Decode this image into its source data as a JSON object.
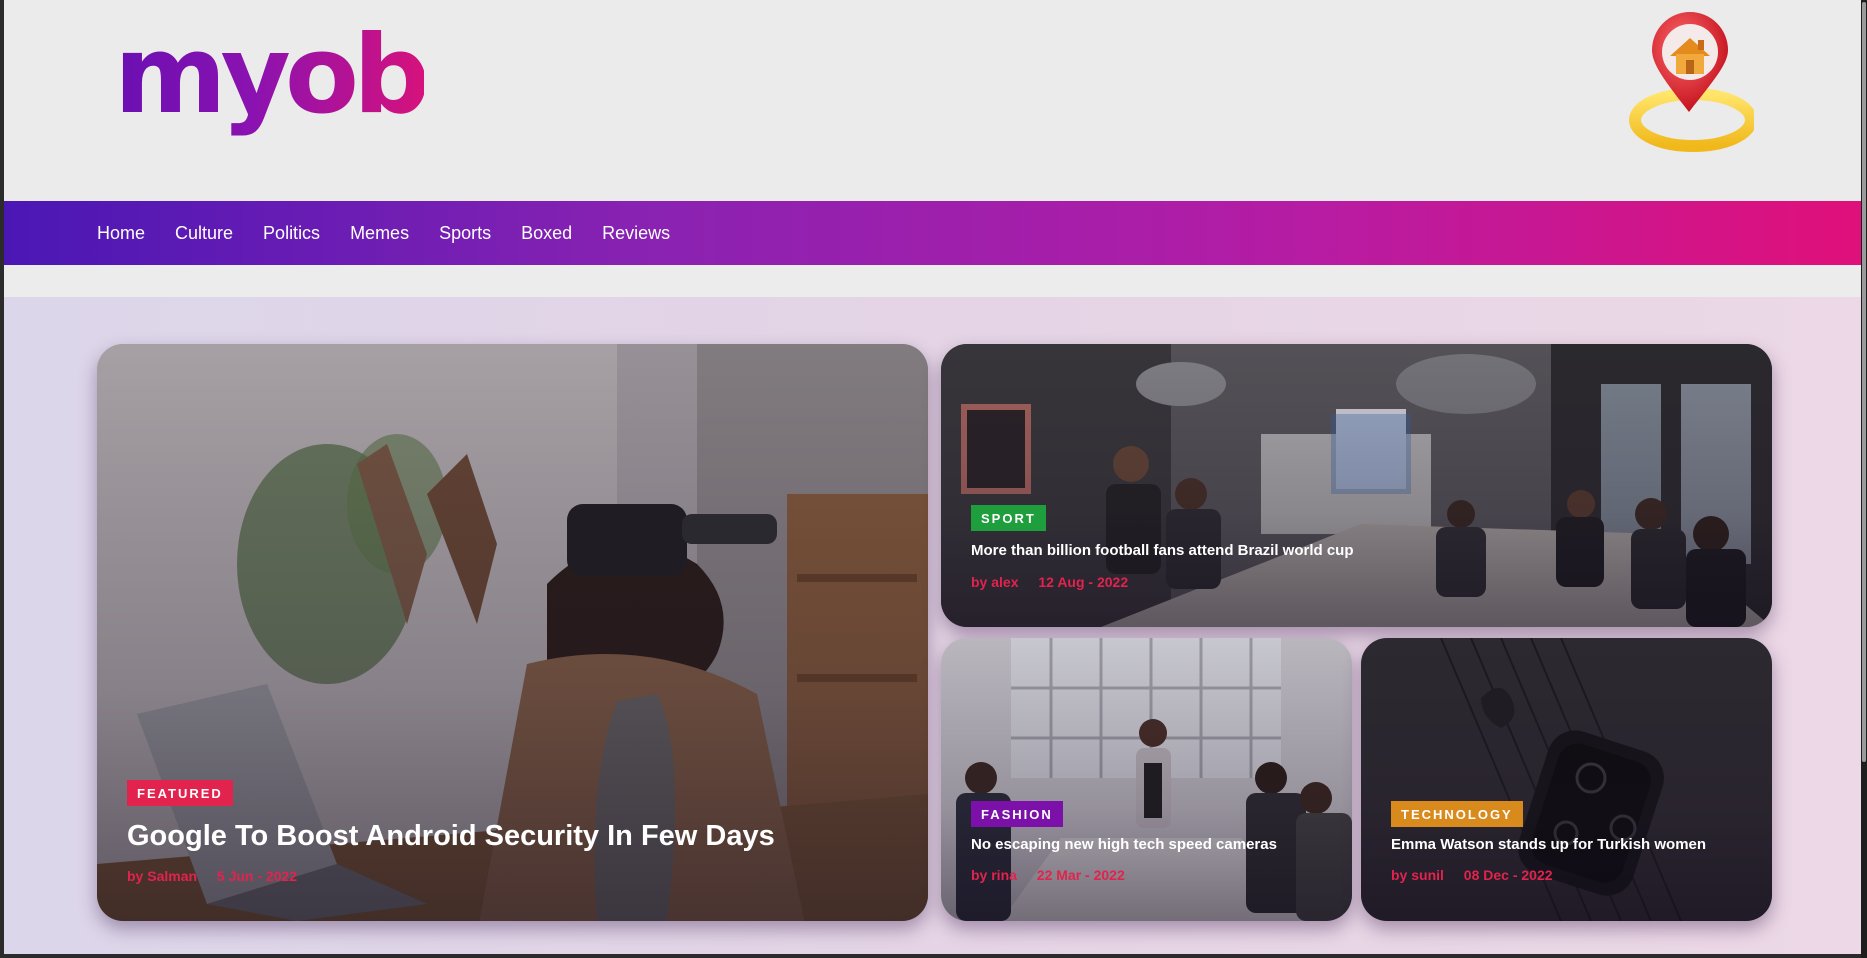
{
  "site": {
    "logo_text": "myob",
    "brand_colors": {
      "purple": "#6a0fb2",
      "pink": "#d6127c"
    }
  },
  "nav": {
    "items": [
      {
        "label": "Home"
      },
      {
        "label": "Culture"
      },
      {
        "label": "Politics"
      },
      {
        "label": "Memes"
      },
      {
        "label": "Sports"
      },
      {
        "label": "Boxed"
      },
      {
        "label": "Reviews"
      }
    ]
  },
  "header": {
    "icon": "home-location-pin-icon"
  },
  "cards": {
    "featured": {
      "badge": "FEATURED",
      "badge_color": "#e2234d",
      "title": "Google To Boost Android Security In Few Days",
      "author": "by Salman",
      "date": "5 Jun - 2022",
      "image": "man-wearing-vr-headset"
    },
    "sport": {
      "badge": "SPORT",
      "badge_color": "#1e9e3c",
      "title": "More than billion football fans attend Brazil world cup",
      "author": "by alex",
      "date": "12 Aug - 2022",
      "image": "office-meeting-room"
    },
    "fashion": {
      "badge": "FASHION",
      "badge_color": "#7b11a8",
      "title": "No escaping new high tech speed cameras",
      "author": "by rina",
      "date": "22 Mar - 2022",
      "image": "business-meeting-table"
    },
    "technology": {
      "badge": "TECHNOLOGY",
      "badge_color": "#d98a1c",
      "title": "Emma Watson stands up for Turkish women",
      "author": "by sunil",
      "date": "08 Dec - 2022",
      "image": "smartwatch-closeup"
    }
  }
}
